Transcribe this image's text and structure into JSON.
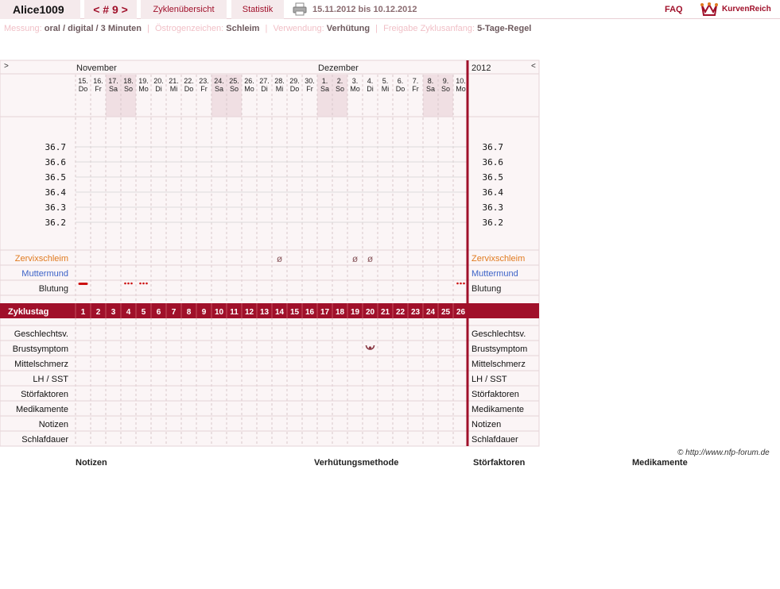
{
  "header": {
    "user": "Alice1009",
    "cycle_nav": "< # 9 >",
    "overview": "Zyklenübersicht",
    "statistics": "Statistik",
    "date_range": "15.11.2012 bis 10.12.2012",
    "faq": "FAQ",
    "logo_text": "KurvenReich"
  },
  "info": [
    {
      "key": "Messung:",
      "value": "oral / digital / 3 Minuten"
    },
    {
      "key": "Östrogenzeichen:",
      "value": "Schleim"
    },
    {
      "key": "Verwendung:",
      "value": "Verhütung"
    },
    {
      "key": "Freigabe Zyklusanfang:",
      "value": "5-Tage-Regel"
    }
  ],
  "chart": {
    "left_arrow": ">",
    "right_arrow": "<",
    "year": "2012",
    "months": [
      {
        "label": "November",
        "start": 0
      },
      {
        "label": "Dezember",
        "start": 16
      }
    ],
    "days": [
      {
        "date": "15.",
        "wd": "Do"
      },
      {
        "date": "16.",
        "wd": "Fr"
      },
      {
        "date": "17.",
        "wd": "Sa"
      },
      {
        "date": "18.",
        "wd": "So"
      },
      {
        "date": "19.",
        "wd": "Mo"
      },
      {
        "date": "20.",
        "wd": "Di"
      },
      {
        "date": "21.",
        "wd": "Mi"
      },
      {
        "date": "22.",
        "wd": "Do"
      },
      {
        "date": "23.",
        "wd": "Fr"
      },
      {
        "date": "24.",
        "wd": "Sa"
      },
      {
        "date": "25.",
        "wd": "So"
      },
      {
        "date": "26.",
        "wd": "Mo"
      },
      {
        "date": "27.",
        "wd": "Di"
      },
      {
        "date": "28.",
        "wd": "Mi"
      },
      {
        "date": "29.",
        "wd": "Do"
      },
      {
        "date": "30.",
        "wd": "Fr"
      },
      {
        "date": "1.",
        "wd": "Sa"
      },
      {
        "date": "2.",
        "wd": "So"
      },
      {
        "date": "3.",
        "wd": "Mo"
      },
      {
        "date": "4.",
        "wd": "Di"
      },
      {
        "date": "5.",
        "wd": "Mi"
      },
      {
        "date": "6.",
        "wd": "Do"
      },
      {
        "date": "7.",
        "wd": "Fr"
      },
      {
        "date": "8.",
        "wd": "Sa"
      },
      {
        "date": "9.",
        "wd": "So"
      },
      {
        "date": "10.",
        "wd": "Mo"
      }
    ],
    "weekend_idx": [
      2,
      3,
      9,
      10,
      16,
      17,
      23,
      24
    ],
    "temp_ticks": [
      "36.7",
      "36.6",
      "36.5",
      "36.4",
      "36.3",
      "36.2"
    ],
    "rows_top": [
      {
        "label": "Zervixschleim",
        "color": "#e07a1f"
      },
      {
        "label": "Muttermund",
        "color": "#3c63c8"
      },
      {
        "label": "Blutung",
        "color": "#222222"
      }
    ],
    "cycle_label": "Zyklustag",
    "cycle_days": [
      "1",
      "2",
      "3",
      "4",
      "5",
      "6",
      "7",
      "8",
      "9",
      "10",
      "11",
      "12",
      "13",
      "14",
      "15",
      "16",
      "17",
      "18",
      "19",
      "20",
      "21",
      "22",
      "23",
      "24",
      "25",
      "26"
    ],
    "rows_bottom": [
      "Geschlechtsv.",
      "Brustsymptom",
      "Mittelschmerz",
      "LH / SST",
      "Störfaktoren",
      "Medikamente",
      "Notizen",
      "Schlafdauer"
    ],
    "mucus_marks": [
      {
        "day": 14,
        "symbol": "ø"
      },
      {
        "day": 19,
        "symbol": "ø"
      },
      {
        "day": 20,
        "symbol": "ø"
      }
    ],
    "bleeding": [
      {
        "day": 1,
        "type": "strong"
      },
      {
        "day": 4,
        "type": "light"
      },
      {
        "day": 5,
        "type": "light"
      },
      {
        "day": 26,
        "type": "light"
      }
    ],
    "breast_symptom_day": 20,
    "accent": "#a0102a",
    "cycle_bar": "#a0102a"
  },
  "copyright": "© http://www.nfp-forum.de",
  "bottom": [
    "Notizen",
    "Verhütungsmethode",
    "Störfaktoren",
    "Medikamente"
  ]
}
